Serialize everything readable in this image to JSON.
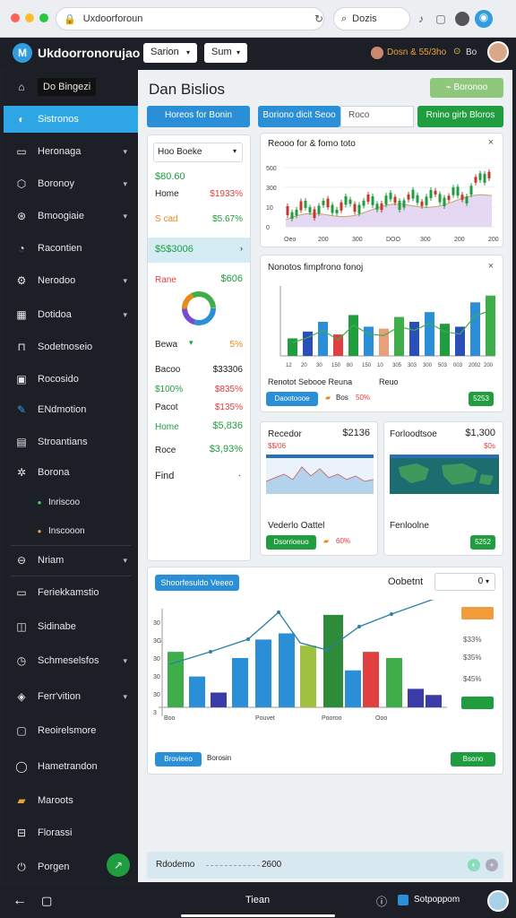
{
  "browser": {
    "url": "Uxdoorforoun",
    "search": "Dozis"
  },
  "app": {
    "title": "Ukdoorronorujao",
    "select1": "Sarion",
    "select2": "Sum",
    "account": "Dosn & 55/3ho",
    "user_badge": "Bo"
  },
  "sidebar": {
    "items": [
      {
        "label": "Do Bingezi",
        "icon": "home-icon"
      },
      {
        "label": "Sistronos",
        "icon": "dashboard-icon"
      },
      {
        "label": "Heronaga",
        "icon": "list-icon"
      },
      {
        "label": "Boronoy",
        "icon": "cube-icon"
      },
      {
        "label": "Bmoogiaie",
        "icon": "compass-icon"
      },
      {
        "label": "Racontien",
        "icon": "chat-icon"
      },
      {
        "label": "Nerodoo",
        "icon": "settings-icon"
      },
      {
        "label": "Dotidoa",
        "icon": "calendar-icon"
      },
      {
        "label": "Sodetnoseio",
        "icon": "bag-icon"
      },
      {
        "label": "Rocosido",
        "icon": "grid-icon"
      },
      {
        "label": "ENdmotion",
        "icon": "edit-icon"
      },
      {
        "label": "Stroantians",
        "icon": "chart-icon"
      },
      {
        "label": "Borona",
        "icon": "gear-icon"
      },
      {
        "label": "Inriscoo",
        "icon": "dot"
      },
      {
        "label": "Inscooon",
        "icon": "dot"
      },
      {
        "label": "Nriam",
        "icon": "user-icon"
      },
      {
        "label": "Feriekkamstio",
        "icon": "doc-icon"
      },
      {
        "label": "Sidinabe",
        "icon": "bell-icon"
      },
      {
        "label": "Schmeselsfos",
        "icon": "clock-icon"
      },
      {
        "label": "Ferr'vition",
        "icon": "layers-icon"
      },
      {
        "label": "Reoirelsmore",
        "icon": "square-icon"
      },
      {
        "label": "Hametrandon",
        "icon": "globe-icon"
      },
      {
        "label": "Maroots",
        "icon": "folder-icon"
      },
      {
        "label": "Florassi",
        "icon": "cart-icon"
      },
      {
        "label": "Porgen",
        "icon": "power-icon"
      }
    ]
  },
  "header": {
    "title": "Dan Bislios",
    "action": "Boronoo"
  },
  "toolbar": {
    "btn1": "Horeos for Bonin",
    "btn2": "Boriono dicit Seoo",
    "input": "Roco",
    "btn3": "Rnino girb Bloros"
  },
  "panel": {
    "select": "Hoo Boeke",
    "rows_top": [
      {
        "a": "$80.60",
        "b": ""
      },
      {
        "a": "Home",
        "b": "$1933%"
      },
      {
        "a": "S cad",
        "b": "$5.67%"
      }
    ],
    "highlight": "$5$3006",
    "rows_mid": [
      {
        "a": "Rane",
        "b": "$606"
      }
    ],
    "rows_low": [
      {
        "a": "Bewa",
        "b": "5%"
      },
      {
        "a": "Bacoo",
        "b": "$33306"
      },
      {
        "a": "$100%",
        "b": "$835%"
      },
      {
        "a": "Pacot",
        "b": "$135%"
      },
      {
        "a": "Home",
        "b": "$5,836"
      },
      {
        "a": "Roce",
        "b": "$3,93%"
      }
    ],
    "footer": "Find"
  },
  "chart1": {
    "title": "Reooo for & fomo toto",
    "yticks": [
      "500",
      "300",
      "10",
      "0"
    ],
    "xticks": [
      "Oeo",
      "200",
      "300",
      "DOO",
      "300",
      "200",
      "200"
    ]
  },
  "chart2": {
    "title": "Nonotos fimpfrono fonoj",
    "xticks": [
      "12",
      "20",
      "30",
      "150",
      "80",
      "150",
      "10",
      "305",
      "303",
      "300",
      "503",
      "003",
      "2002",
      "200"
    ],
    "caption": "Renotot Sebooe Reuna",
    "meta": "Reuo",
    "btn": "Daootoooe",
    "legend": "Bos",
    "pct": "50%",
    "badge": "5253"
  },
  "stat1": {
    "label": "Recedor",
    "value": "$2136",
    "sub": "$$/06",
    "btn": "Dsorrioeuo",
    "caption": "Vederlo Oattel",
    "pct": "60%",
    "badge": "5252"
  },
  "stat2": {
    "label": "Forloodtsoe",
    "value": "$1,300",
    "sub": "$0s",
    "caption": "Fenloolne"
  },
  "big_chart": {
    "tab": "Shoorfesuldo Veeeo",
    "label": "Oobetnt",
    "select": "0",
    "right_badge1": "",
    "right_labels": [
      "$33%",
      "$35%",
      "$45%"
    ],
    "right_badge2": "",
    "xticks": [
      "Boo",
      "Pouvet",
      "Pooroo",
      "Ooo"
    ],
    "yticks": [
      "30",
      "3G",
      "30",
      "30",
      "30",
      "3"
    ],
    "btn": "Brovieeo",
    "legend": "Borosin",
    "badge": "Bsono"
  },
  "footer_bar": {
    "label": "Rdodemo",
    "value": "2600"
  },
  "bottom": {
    "center": "Tiean",
    "right": "Sotpoppom"
  },
  "chart_data": [
    {
      "type": "line",
      "title": "Reooo for & fomo toto",
      "note": "candlestick-style price series with area",
      "x": [
        "Oeo",
        "200",
        "300",
        "DOO",
        "300",
        "200",
        "200"
      ],
      "yticks": [
        500,
        300,
        10,
        0
      ]
    },
    {
      "type": "bar",
      "title": "Nonotos fimpfrono fonoj",
      "series": [
        {
          "name": "",
          "values": [
            18,
            25,
            35,
            22,
            42,
            30,
            28,
            40,
            35,
            45,
            33,
            30,
            55,
            62
          ]
        }
      ]
    },
    {
      "type": "bar",
      "title": "Oobetnt",
      "categories": [
        "Boo",
        "Pouvet",
        "Pooroo",
        "Ooo"
      ],
      "series": [
        {
          "name": "",
          "values": [
            45,
            25,
            12,
            40,
            55,
            60,
            50,
            75,
            30,
            45,
            40,
            15,
            10
          ]
        }
      ]
    }
  ]
}
